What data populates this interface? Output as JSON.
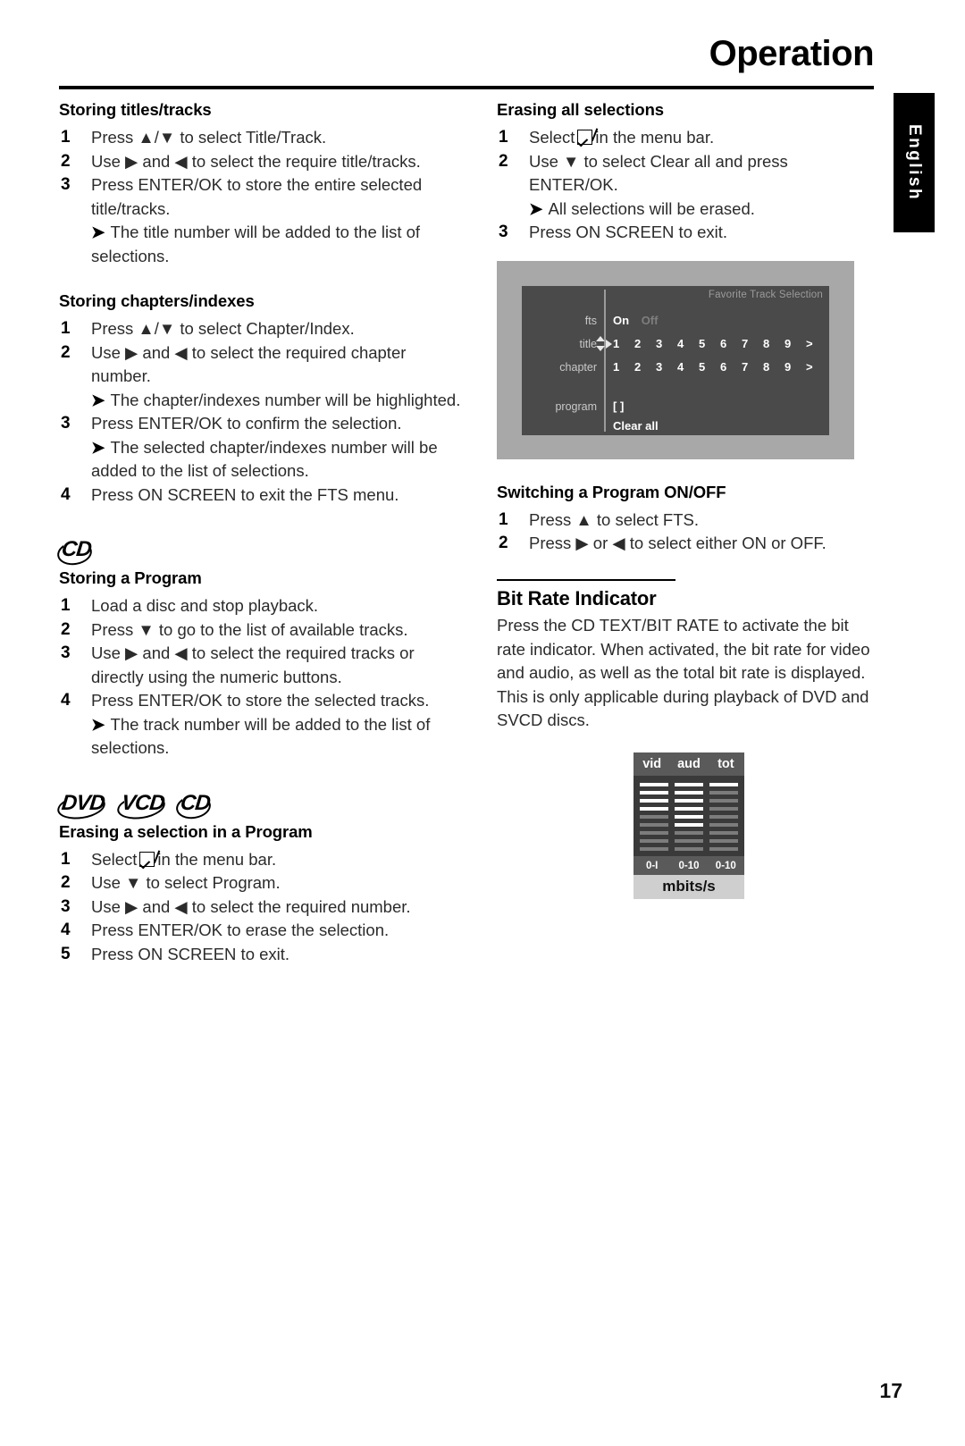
{
  "header": {
    "title": "Operation"
  },
  "language_tab": {
    "label": "English"
  },
  "page_number": "17",
  "left_column": {
    "section1": {
      "heading": "Storing titles/tracks",
      "steps": [
        {
          "num": "1",
          "text": "Press ▲/▼ to select Title/Track."
        },
        {
          "num": "2",
          "text": "Use ▶ and ◀ to select the require title/tracks."
        },
        {
          "num": "3",
          "text": "Press ENTER/OK to store the entire selected title/tracks."
        }
      ],
      "note": "The title number will be added to the list of selections."
    },
    "section2": {
      "heading": "Storing chapters/indexes",
      "step1": "Press ▲/▼ to select Chapter/Index.",
      "step1_num": "1",
      "step2": "Use ▶ and ◀ to select the required chapter number.",
      "step2_num": "2",
      "note2": "The chapter/indexes number will be highlighted.",
      "step3": "Press ENTER/OK to confirm the selection.",
      "step3_num": "3",
      "note3": "The selected chapter/indexes number will be added to the list of selections.",
      "step4": "Press ON SCREEN to exit the FTS menu.",
      "step4_num": "4"
    },
    "section3": {
      "logos": [
        "CD"
      ],
      "heading": "Storing a Program",
      "steps": [
        {
          "num": "1",
          "text": "Load a disc and stop playback."
        },
        {
          "num": "2",
          "text": "Press ▼ to go to the list of available tracks."
        },
        {
          "num": "3",
          "text": "Use ▶ and ◀ to select the required tracks or directly using the numeric buttons."
        },
        {
          "num": "4",
          "text": "Press ENTER/OK to store the selected tracks."
        }
      ],
      "note": "The track number will be added to the list of selections."
    },
    "section4": {
      "logos": [
        "DVD",
        "VCD",
        "CD"
      ],
      "heading": "Erasing a selection in a Program",
      "step1_num": "1",
      "step1_pre": "Select",
      "step1_post": "in the menu bar.",
      "steps": [
        {
          "num": "2",
          "text": "Use ▼ to select Program."
        },
        {
          "num": "3",
          "text": "Use ▶ and ◀ to select the required number."
        },
        {
          "num": "4",
          "text": "Press ENTER/OK to erase the selection."
        },
        {
          "num": "5",
          "text": "Press ON SCREEN to exit."
        }
      ]
    }
  },
  "right_column": {
    "section1": {
      "heading": "Erasing all selections",
      "step1_num": "1",
      "step1_pre": "Select",
      "step1_post": "in the menu bar.",
      "step2_num": "2",
      "step2": "Use ▼ to select Clear all and press ENTER/OK.",
      "note": "All selections will be erased.",
      "step3_num": "3",
      "step3": "Press ON SCREEN to exit."
    },
    "osd": {
      "title": "Favorite Track Selection",
      "rows": [
        {
          "label": "fts",
          "on": "On",
          "off": "Off"
        },
        {
          "label": "title",
          "numbers": [
            "1",
            "2",
            "3",
            "4",
            "5",
            "6",
            "7",
            "8",
            "9"
          ],
          "chevron": ">"
        },
        {
          "label": "chapter",
          "numbers": [
            "1",
            "2",
            "3",
            "4",
            "5",
            "6",
            "7",
            "8",
            "9"
          ],
          "chevron": ">"
        },
        {
          "label": "program",
          "value": "[ ]"
        }
      ],
      "clear_all": "Clear all"
    },
    "section2": {
      "heading": "Switching a Program ON/OFF",
      "steps": [
        {
          "num": "1",
          "text": "Press ▲ to select FTS."
        },
        {
          "num": "2",
          "text": "Press ▶ or ◀ to select either ON or OFF."
        }
      ]
    },
    "section3": {
      "heading": "Bit Rate Indicator",
      "body": "Press the CD TEXT/BIT RATE to activate the bit rate indicator. When activated, the bit rate for video and audio, as well as the total bit rate is displayed. This is only applicable during playback of DVD and SVCD discs."
    },
    "bitrate_widget": {
      "columns": [
        "vid",
        "aud",
        "tot"
      ],
      "scales": [
        "0-I",
        "0-10",
        "0-10"
      ],
      "unit": "mbits/s",
      "levels": {
        "vid": 4,
        "aud": 6,
        "tot": 1
      },
      "segments_total": 9,
      "colors": {
        "bar_on": "#ffffff",
        "bar_off": "#7c7c7c",
        "panel": "#3a3a3a",
        "header": "#5a5a5a",
        "footer": "#cfcfcf"
      }
    }
  }
}
